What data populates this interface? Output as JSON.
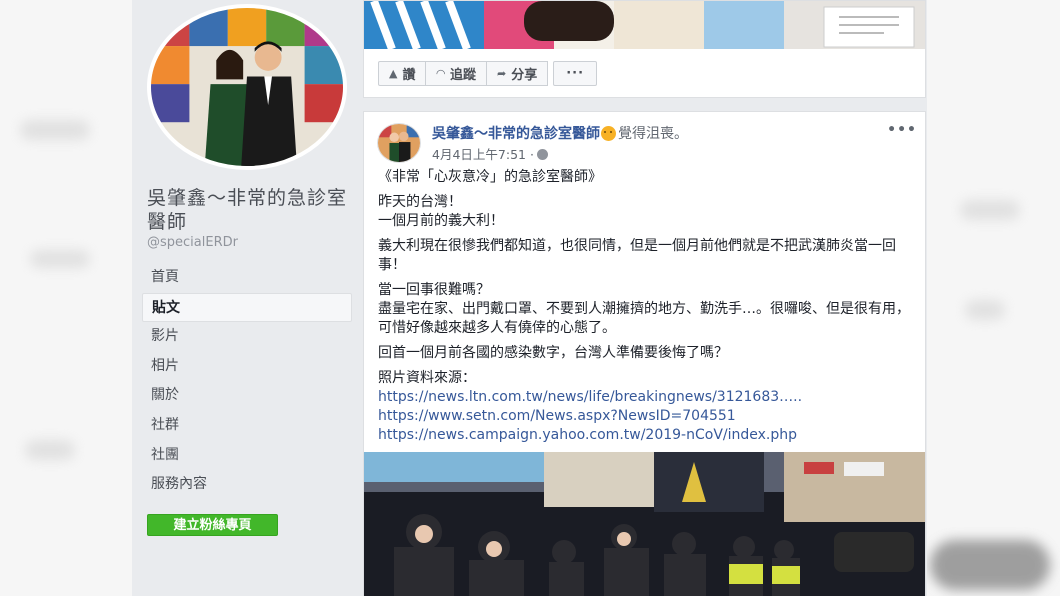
{
  "page": {
    "name": "吳肇鑫～非常的急診室醫師",
    "handle": "@specialERDr"
  },
  "nav": {
    "items": [
      {
        "label": "首頁"
      },
      {
        "label": "貼文"
      },
      {
        "label": "影片"
      },
      {
        "label": "相片"
      },
      {
        "label": "關於"
      },
      {
        "label": "社群"
      },
      {
        "label": "社團"
      },
      {
        "label": "服務內容"
      }
    ],
    "active_index": 1
  },
  "create_page_button": "建立粉絲專頁",
  "actions": {
    "like": "讚",
    "follow": "追蹤",
    "share": "分享",
    "more": "···"
  },
  "post": {
    "author": "吳肇鑫～非常的急診室醫師",
    "feeling": "覺得沮喪。",
    "timestamp": "4月4日上午7:51 ·",
    "menu": "•••",
    "paragraphs": [
      "《非常「心灰意冷」的急診室醫師》",
      "昨天的台灣！\n一個月前的義大利！",
      "義大利現在很慘我們都知道，也很同情，但是一個月前他們就是不把武漢肺炎當一回事！",
      "當一回事很難嗎？\n盡量宅在家、出門戴口罩、不要到人潮擁擠的地方、勤洗手…。很囉唆、但是很有用，可惜好像越來越多人有僥倖的心態了。",
      "回首一個月前各國的感染數字，台灣人準備要後悔了嗎？"
    ],
    "source_label": "照片資料來源：",
    "links": [
      "https://news.ltn.com.tw/news/life/breakingnews/3121683…..",
      "https://www.setn.com/News.aspx?NewsID=704551",
      "https://news.campaign.yahoo.com.tw/2019-nCoV/index.php"
    ]
  },
  "colors": {
    "link": "#365899",
    "create_button": "#42b72a",
    "feeling_emoji": "#f7b125"
  },
  "icons": {
    "like": "thumbs-up-icon",
    "follow": "rss-icon",
    "share": "share-arrow-icon",
    "privacy": "globe-icon"
  }
}
